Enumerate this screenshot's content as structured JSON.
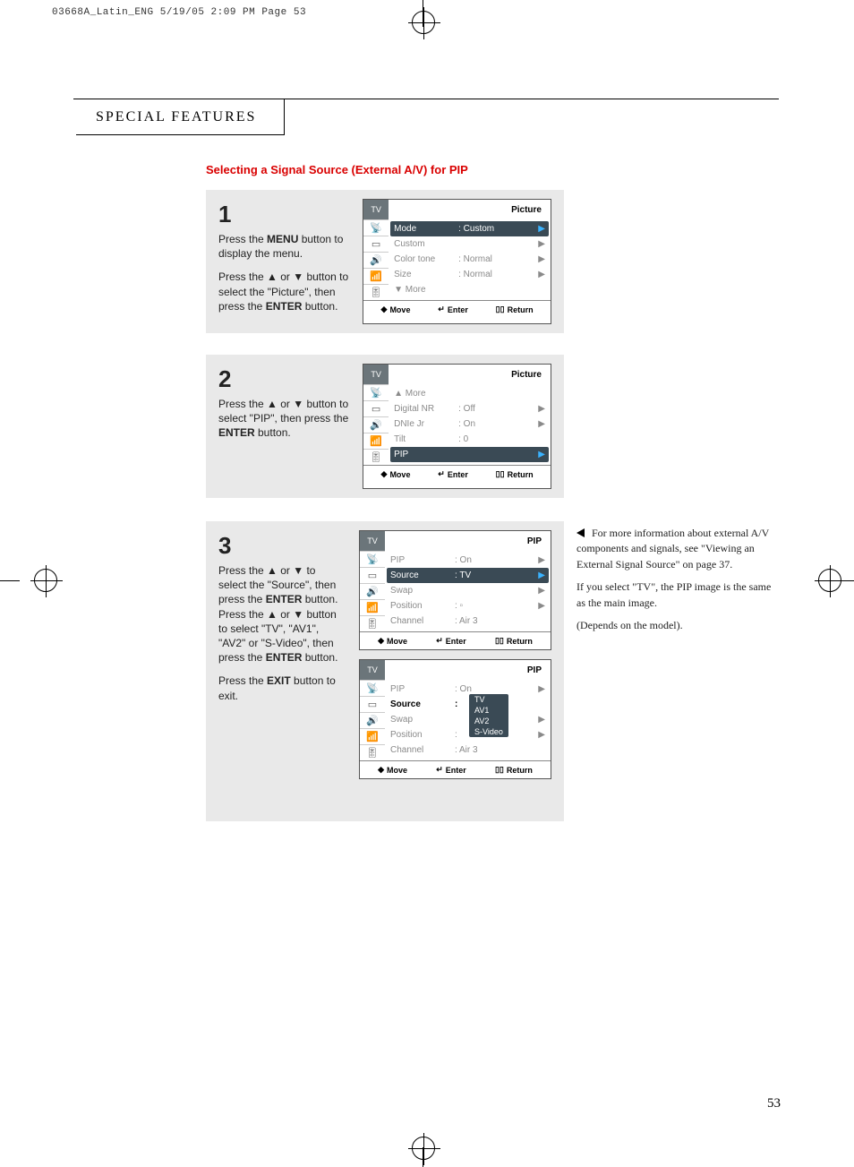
{
  "print_header": "03668A_Latin_ENG  5/19/05  2:09 PM  Page 53",
  "chapter": "SPECIAL FEATURES",
  "section_title": "Selecting a Signal Source (External A/V) for PIP",
  "page_number": "53",
  "steps": {
    "s1": {
      "num": "1",
      "p1a": "Press the ",
      "p1b": "MENU",
      "p1c": " button to display the menu.",
      "p2a": "Press the ▲ or ▼ button to select the \"Picture\", then press the ",
      "p2b": "ENTER",
      "p2c": " button."
    },
    "s2": {
      "num": "2",
      "p1a": "Press the ▲ or ▼ button to select \"PIP\", then press the ",
      "p1b": "ENTER",
      "p1c": " button."
    },
    "s3": {
      "num": "3",
      "p1a": "Press the ▲ or ▼ to select the \"Source\", then press the ",
      "p1b": "ENTER",
      "p1c": " button. Press the ▲ or ▼ button to select \"TV\", \"AV1\", \"AV2\" or \"S-Video\", then press the ",
      "p1d": "ENTER",
      "p1e": " button.",
      "p2a": "Press the ",
      "p2b": "EXIT",
      "p2c": " button to exit."
    }
  },
  "osd1": {
    "tv": "TV",
    "title": "Picture",
    "r1l": "Mode",
    "r1v": ":  Custom",
    "r2l": "Custom",
    "r3l": "Color tone",
    "r3v": ":  Normal",
    "r4l": "Size",
    "r4v": ":  Normal",
    "r5l": "▼ More",
    "foot_move": "Move",
    "foot_enter": "Enter",
    "foot_return": "Return"
  },
  "osd2": {
    "tv": "TV",
    "title": "Picture",
    "r1l": "▲ More",
    "r2l": "Digital NR",
    "r2v": ":  Off",
    "r3l": "DNIe Jr",
    "r3v": ":  On",
    "r4l": "Tilt",
    "r4v": ":  0",
    "r5l": "PIP",
    "foot_move": "Move",
    "foot_enter": "Enter",
    "foot_return": "Return"
  },
  "osd3a": {
    "tv": "TV",
    "title": "PIP",
    "r1l": "PIP",
    "r1v": ":  On",
    "r2l": "Source",
    "r2v": ":  TV",
    "r3l": "Swap",
    "r4l": "Position",
    "r4v": ":  ▫",
    "r5l": "Channel",
    "r5v": ":  Air   3",
    "foot_move": "Move",
    "foot_enter": "Enter",
    "foot_return": "Return"
  },
  "osd3b": {
    "tv": "TV",
    "title": "PIP",
    "r1l": "PIP",
    "r1v": ":  On",
    "r2l": "Source",
    "r2v": ":",
    "r3l": "Swap",
    "r4l": "Position",
    "r4v": ":",
    "r5l": "Channel",
    "r5v": ":  Air   3",
    "pop1": "TV",
    "pop2": "AV1",
    "pop3": "AV2",
    "pop4": "S-Video",
    "foot_move": "Move",
    "foot_enter": "Enter",
    "foot_return": "Return"
  },
  "note": {
    "p1": "For more information about external A/V components and signals, see \"Viewing an External Signal Source\" on page 37.",
    "p2": "If you select \"TV\", the PIP image is the same as the main image.",
    "p3": "(Depends on the model)."
  }
}
